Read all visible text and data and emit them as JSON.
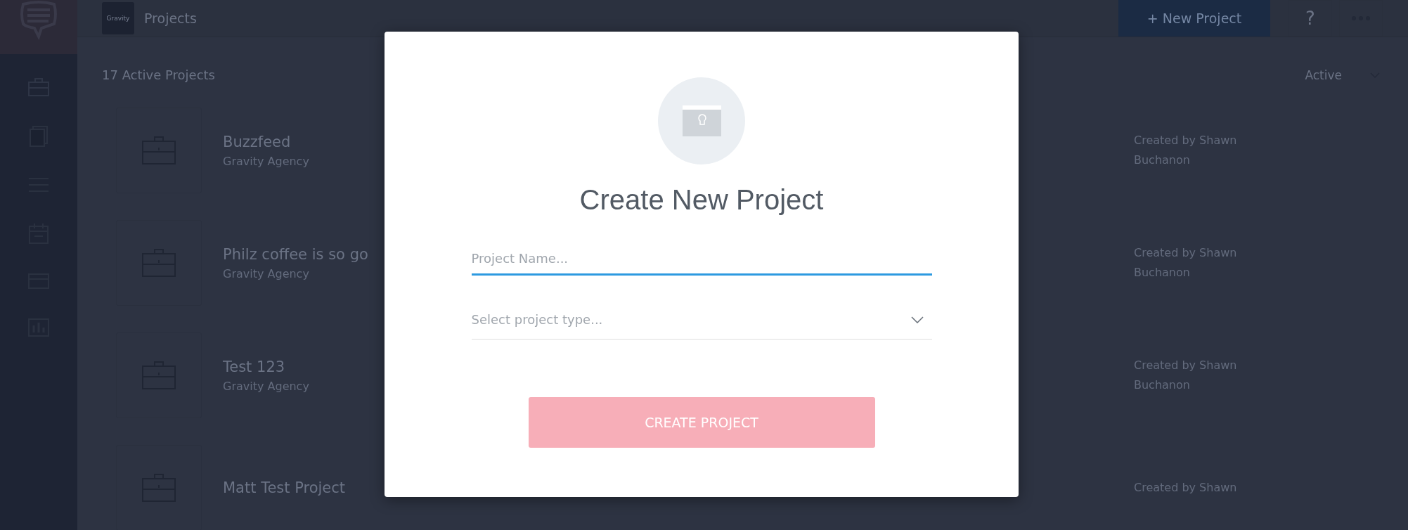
{
  "header": {
    "logo_text": "Gravity",
    "title": "Projects",
    "new_button": "+ New Project",
    "help_button": "?"
  },
  "summary": "17 Active Projects",
  "filter": {
    "value": "Active"
  },
  "projects": [
    {
      "title": "Buzzfeed",
      "subtitle": "Gravity Agency",
      "creator": "Created by Shawn Buchanon"
    },
    {
      "title": "Philz coffee is so go",
      "subtitle": "Gravity Agency",
      "creator": "Created by Shawn Buchanon"
    },
    {
      "title": "Test 123",
      "subtitle": "Gravity Agency",
      "creator": "Created by Shawn Buchanon"
    },
    {
      "title": "Matt Test Project",
      "creator": "Created by Shawn"
    }
  ],
  "dialog": {
    "title": "Create New Project",
    "name_field": {
      "placeholder": "Project Name...",
      "focused": true
    },
    "type_select": {
      "placeholder": "Select project type..."
    },
    "submit": {
      "label": "CREATE PROJECT",
      "disabled": true
    }
  }
}
